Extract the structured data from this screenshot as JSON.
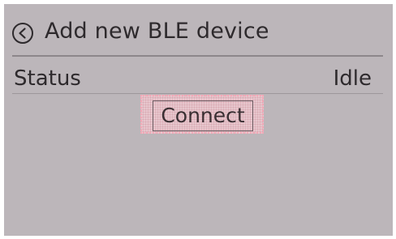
{
  "header": {
    "back_icon": "chevron-left-circle-icon",
    "title": "Add new BLE device"
  },
  "status": {
    "label": "Status",
    "value": "Idle"
  },
  "actions": {
    "connect_label": "Connect"
  },
  "colors": {
    "background": "#bcb6ba",
    "text": "#2e2a2d",
    "focus_highlight": "#e7c6cd",
    "focus_border": "#f4a7b6"
  }
}
